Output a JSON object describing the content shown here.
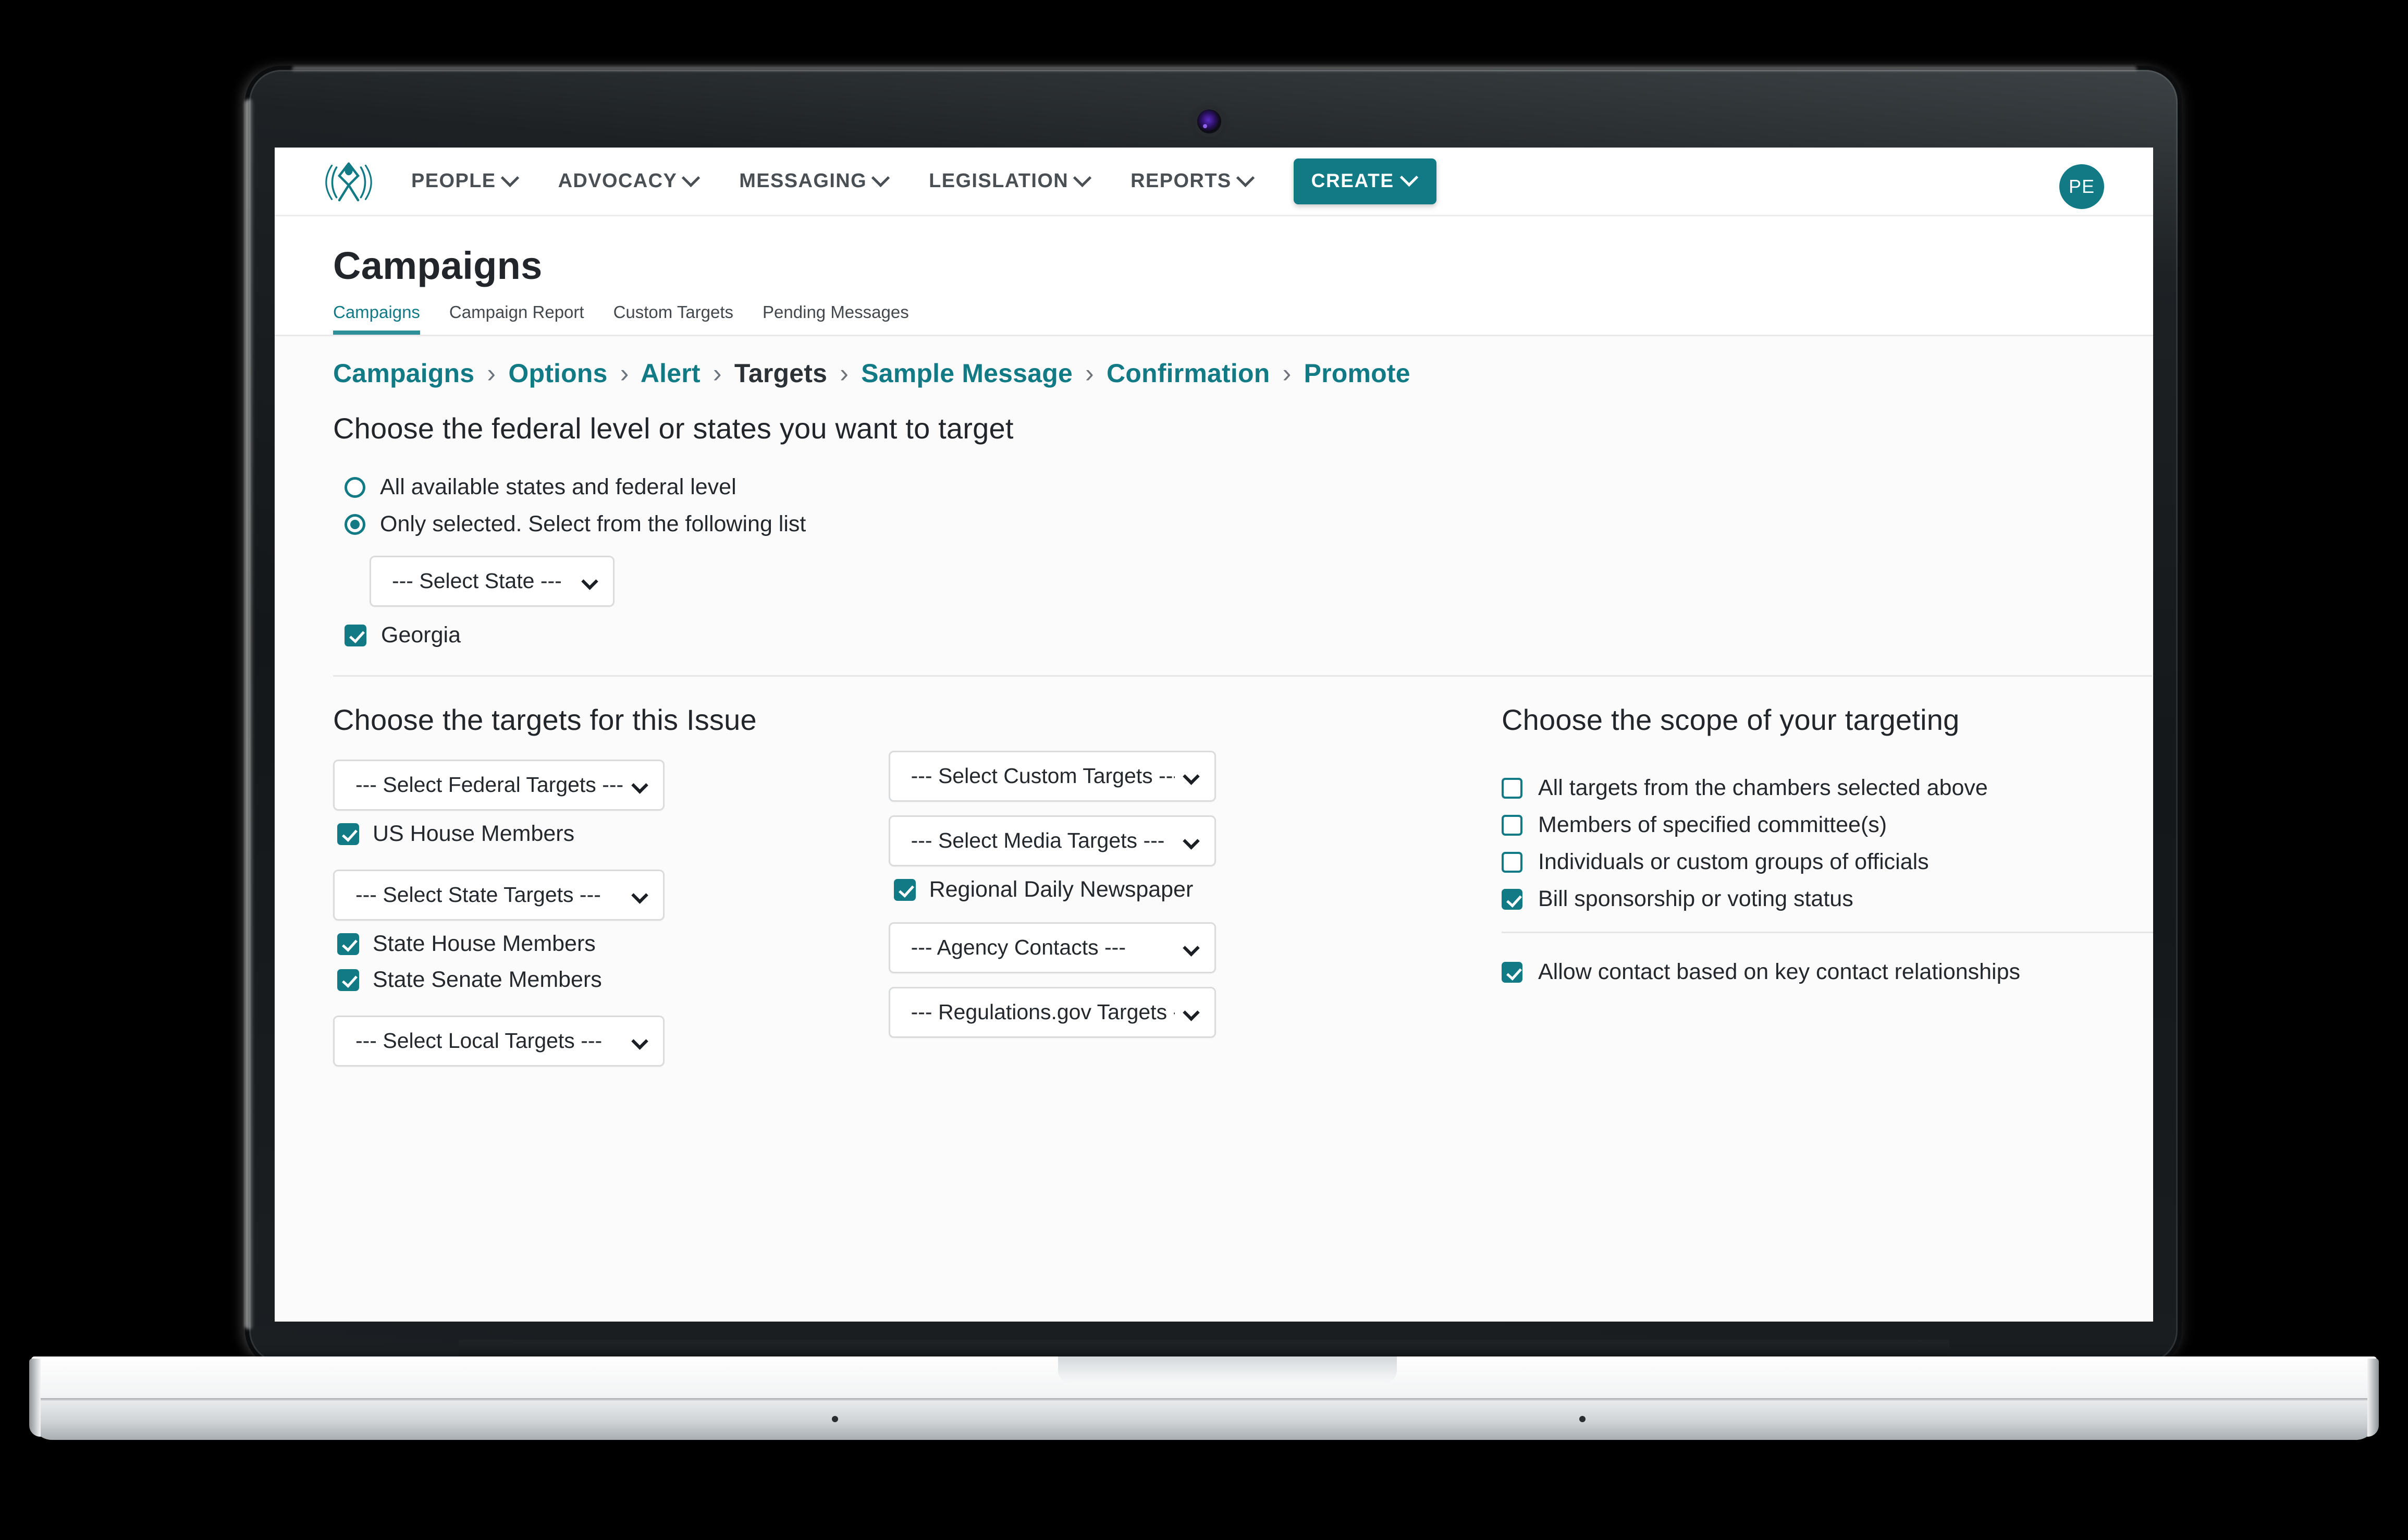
{
  "topnav": {
    "logo_icon": "advocacy-person-signal-logo",
    "items": [
      {
        "label": "PEOPLE",
        "icon": "chevron-down-icon"
      },
      {
        "label": "ADVOCACY",
        "icon": "chevron-down-icon"
      },
      {
        "label": "MESSAGING",
        "icon": "chevron-down-icon"
      },
      {
        "label": "LEGISLATION",
        "icon": "chevron-down-icon"
      },
      {
        "label": "REPORTS",
        "icon": "chevron-down-icon"
      }
    ],
    "create_button": {
      "label": "CREATE",
      "icon": "chevron-down-icon"
    },
    "avatar_initials": "PE"
  },
  "page": {
    "title": "Campaigns",
    "tabs": [
      {
        "label": "Campaigns",
        "active": true
      },
      {
        "label": "Campaign Report",
        "active": false
      },
      {
        "label": "Custom Targets",
        "active": false
      },
      {
        "label": "Pending Messages",
        "active": false
      }
    ],
    "breadcrumb": {
      "separator": "›",
      "items": [
        {
          "label": "Campaigns",
          "current": false
        },
        {
          "label": "Options",
          "current": false
        },
        {
          "label": "Alert",
          "current": false
        },
        {
          "label": "Targets",
          "current": true
        },
        {
          "label": "Sample Message",
          "current": false
        },
        {
          "label": "Confirmation",
          "current": false
        },
        {
          "label": "Promote",
          "current": false
        }
      ]
    }
  },
  "states_section": {
    "heading": "Choose the federal level or states you want to target",
    "radios": [
      {
        "label": "All available states and federal level",
        "checked": false
      },
      {
        "label": "Only selected. Select from the following list",
        "checked": true
      }
    ],
    "state_select": {
      "value": "--- Select State ---",
      "options": [
        "--- Select State ---"
      ]
    },
    "selected_states": [
      {
        "label": "Georgia",
        "checked": true
      }
    ]
  },
  "targets_section": {
    "heading": "Choose the targets for this Issue",
    "left_groups": [
      {
        "select": {
          "value": "--- Select Federal Targets ---"
        },
        "checkboxes": [
          {
            "label": "US House Members",
            "checked": true
          }
        ]
      },
      {
        "select": {
          "value": "--- Select State Targets ---"
        },
        "checkboxes": [
          {
            "label": "State House Members",
            "checked": true
          },
          {
            "label": "State Senate Members",
            "checked": true
          }
        ]
      },
      {
        "select": {
          "value": "--- Select Local Targets ---"
        },
        "checkboxes": []
      }
    ],
    "mid_groups": [
      {
        "select": {
          "value": "--- Select Custom Targets ---"
        },
        "checkboxes": []
      },
      {
        "select": {
          "value": "--- Select Media Targets ---"
        },
        "checkboxes": [
          {
            "label": "Regional Daily Newspaper",
            "checked": true
          }
        ]
      },
      {
        "select": {
          "value": "--- Agency Contacts ---"
        },
        "checkboxes": []
      },
      {
        "select": {
          "value": "--- Regulations.gov Targets ---"
        },
        "checkboxes": []
      }
    ]
  },
  "scope_section": {
    "heading": "Choose the scope of your targeting",
    "options": [
      {
        "label": "All targets from the chambers selected above",
        "checked": false
      },
      {
        "label": "Members of specified committee(s)",
        "checked": false
      },
      {
        "label": "Individuals or custom groups of officials",
        "checked": false
      },
      {
        "label": "Bill sponsorship or voting status",
        "checked": true
      }
    ],
    "key_contact": {
      "label": "Allow contact based on key contact relationships",
      "checked": true
    }
  },
  "colors": {
    "accent_teal": "#117a85",
    "tab_underline": "#2f8f99",
    "text_dark": "#22262a",
    "page_bg": "#fbfbfb",
    "border_grey": "#d9dbdd"
  }
}
